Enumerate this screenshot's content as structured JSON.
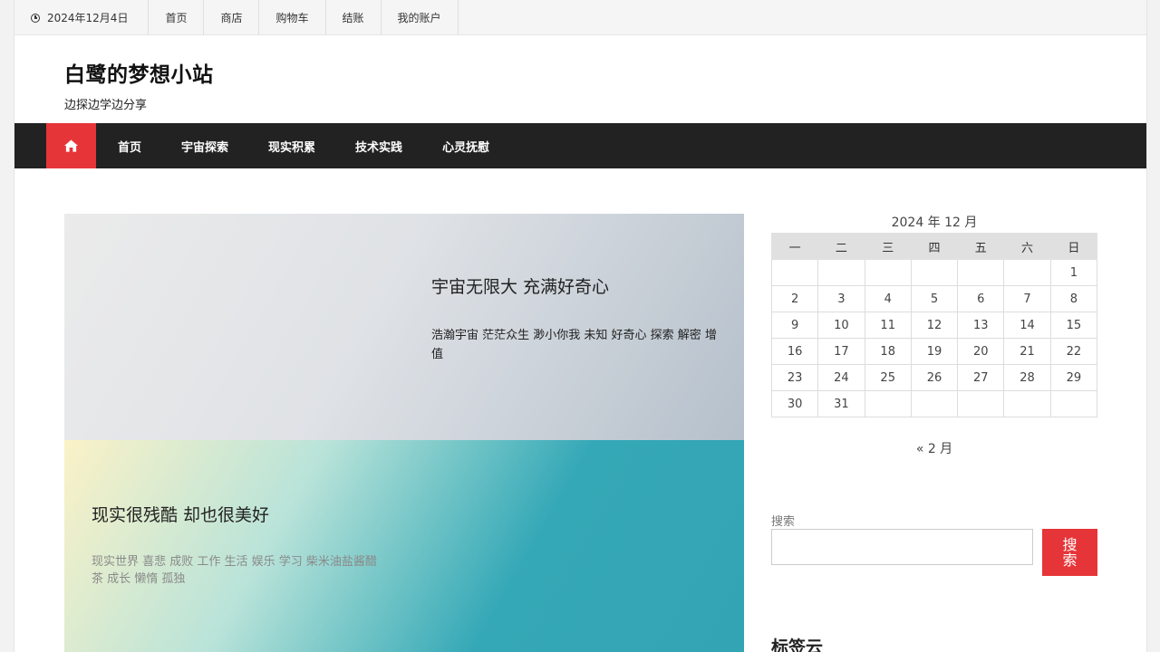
{
  "topbar": {
    "date": "2024年12月4日",
    "links": [
      "首页",
      "商店",
      "购物车",
      "结账",
      "我的账户"
    ]
  },
  "header": {
    "title": "白鹭的梦想小站",
    "description": "边探边学边分享"
  },
  "nav": {
    "home_icon": "home-icon",
    "items": [
      "首页",
      "宇宙探索",
      "现实积累",
      "技术实践",
      "心灵抚慰"
    ]
  },
  "slides": [
    {
      "title": "宇宙无限大 充满好奇心",
      "text": "浩瀚宇宙 茫茫众生 渺小你我 未知 好奇心 探索 解密 增值"
    },
    {
      "title": "现实很残酷 却也很美好",
      "text": "现实世界 喜悲 成败 工作 生活 娱乐 学习 柴米油盐酱醋茶 成长 懒惰 孤独"
    }
  ],
  "calendar": {
    "caption": "2024 年 12 月",
    "weekdays": [
      "一",
      "二",
      "三",
      "四",
      "五",
      "六",
      "日"
    ],
    "weeks": [
      [
        "",
        "",
        "",
        "",
        "",
        "",
        "1"
      ],
      [
        "2",
        "3",
        "4",
        "5",
        "6",
        "7",
        "8"
      ],
      [
        "9",
        "10",
        "11",
        "12",
        "13",
        "14",
        "15"
      ],
      [
        "16",
        "17",
        "18",
        "19",
        "20",
        "21",
        "22"
      ],
      [
        "23",
        "24",
        "25",
        "26",
        "27",
        "28",
        "29"
      ],
      [
        "30",
        "31",
        "",
        "",
        "",
        "",
        ""
      ]
    ],
    "prev_link": "« 2 月"
  },
  "search": {
    "label": "搜索",
    "placeholder": "",
    "button": "搜索"
  },
  "tagcloud": {
    "title": "标签云"
  },
  "colors": {
    "accent": "#e63538",
    "nav_bg": "#222222"
  }
}
